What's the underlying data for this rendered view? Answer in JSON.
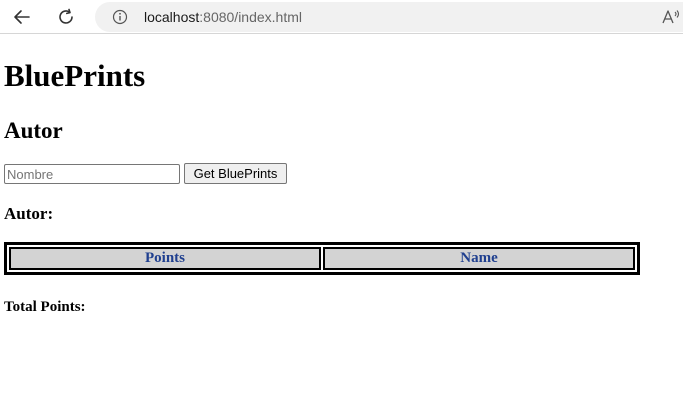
{
  "browser": {
    "url_host": "localhost",
    "url_rest": ":8080/index.html",
    "read_aloud": "A ’"
  },
  "page": {
    "title": "BluePrints",
    "section": "Autor",
    "search": {
      "placeholder": "Nombre",
      "value": ""
    },
    "get_button": "Get BluePrints",
    "author_label": "Autor:",
    "table": {
      "headers": [
        "Points",
        "Name"
      ],
      "rows": []
    },
    "total_label": "Total Points:"
  },
  "colors": {
    "header_text": "#1f3f8f",
    "header_bg": "#d3d3d3"
  }
}
